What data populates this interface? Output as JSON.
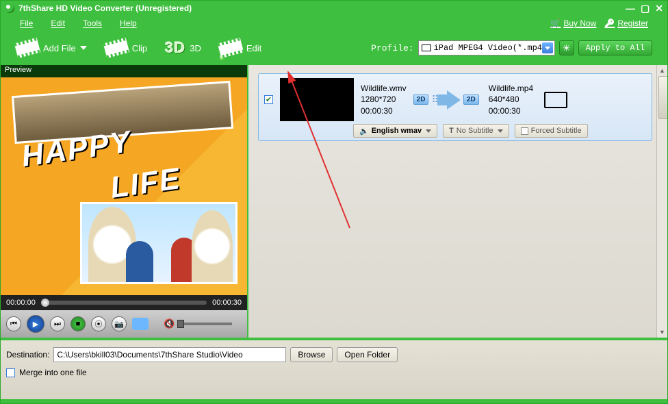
{
  "titlebar": {
    "title": "7thShare HD Video Converter (Unregistered)"
  },
  "menubar": {
    "file": "File",
    "edit": "Edit",
    "tools": "Tools",
    "help": "Help",
    "buy": "Buy Now",
    "register": "Register"
  },
  "toolbar": {
    "add_file": "Add File",
    "clip": "Clip",
    "threeD_big": "3D",
    "threeD_small": "3D",
    "edit": "Edit",
    "profile_label": "Profile:",
    "profile_value": "iPad MPEG4 Video(*.mp4)",
    "apply_all": "Apply to All"
  },
  "preview": {
    "title": "Preview",
    "time_start": "00:00:00",
    "time_end": "00:00:30",
    "happy": "HAPPY",
    "life": "LIFE"
  },
  "file_item": {
    "checked": "✔",
    "src_name": "Wildlife.wmv",
    "src_res": "1280*720",
    "src_dur": "00:00:30",
    "dst_name": "Wildlife.mp4",
    "dst_res": "640*480",
    "dst_dur": "00:00:30",
    "badge2d": "2D",
    "audio_track": "English wmav",
    "no_subtitle": "No Subtitle",
    "forced_subtitle": "Forced Subtitle"
  },
  "bottom": {
    "dest_label": "Destination:",
    "dest_path": "C:\\Users\\bkill03\\Documents\\7thShare Studio\\Video",
    "browse": "Browse",
    "open_folder": "Open Folder",
    "merge": "Merge into one file"
  }
}
